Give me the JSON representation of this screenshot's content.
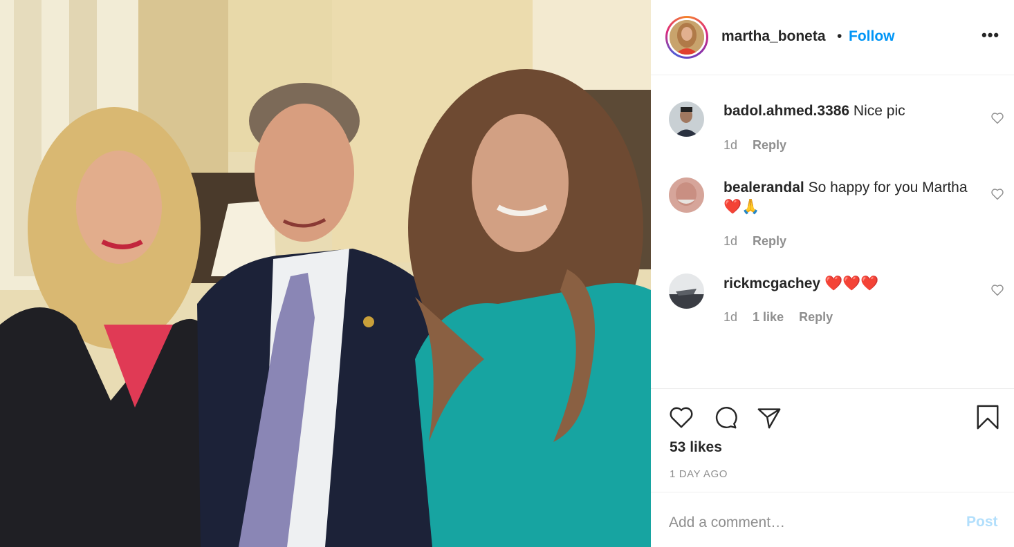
{
  "post": {
    "photo_alt": "Group photo of three people",
    "author": {
      "username": "martha_boneta",
      "separator": "•",
      "follow_label": "Follow",
      "more_icon": "more-options-icon",
      "more_glyph": "•••"
    },
    "comments": [
      {
        "username": "badol.ahmed.3386",
        "text": "Nice pic",
        "time": "1d",
        "likes": "",
        "reply_label": "Reply"
      },
      {
        "username": "bealerandal",
        "text": "So happy for you Martha ❤️🙏",
        "time": "1d",
        "likes": "",
        "reply_label": "Reply"
      },
      {
        "username": "rickmcgachey",
        "text": "❤️❤️❤️",
        "time": "1d",
        "likes": "1 like",
        "reply_label": "Reply"
      }
    ],
    "actions": {
      "like_icon": "heart-icon",
      "comment_icon": "comment-bubble-icon",
      "share_icon": "share-paper-plane-icon",
      "save_icon": "bookmark-icon"
    },
    "likes_label": "53 likes",
    "time_ago": "1 DAY AGO",
    "add_comment": {
      "placeholder": "Add a comment…",
      "post_label": "Post"
    },
    "colors": {
      "link": "#0095f6",
      "post_disabled": "#b2dffc",
      "muted": "#8e8e8e",
      "text": "#262626"
    }
  }
}
